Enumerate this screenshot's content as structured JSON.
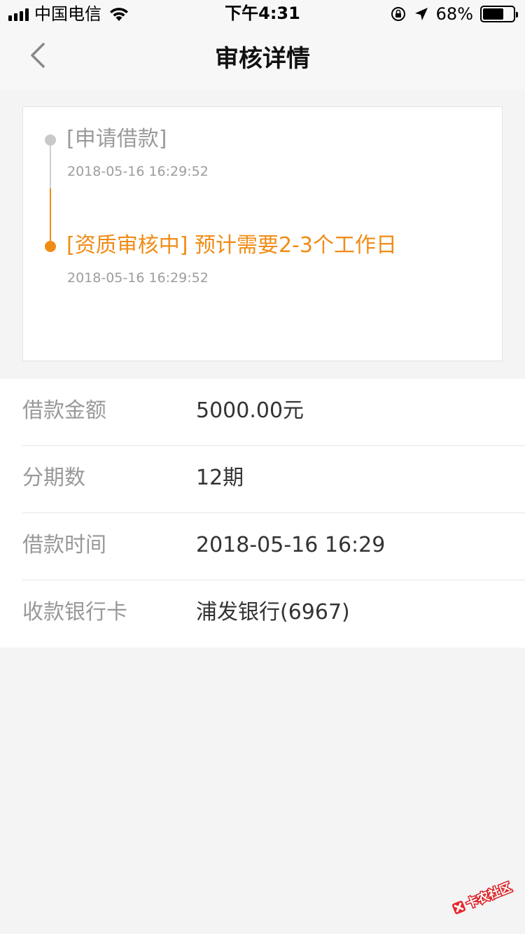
{
  "status_bar": {
    "carrier": "中国电信",
    "time": "下午4:31",
    "battery": "68%",
    "battery_level": 0.68
  },
  "nav": {
    "title": "审核详情"
  },
  "timeline": [
    {
      "title": "[申请借款]",
      "time": "2018-05-16 16:29:52",
      "status": "done"
    },
    {
      "title": "[资质审核中] 预计需要2-3个工作日",
      "time": "2018-05-16 16:29:52",
      "status": "active"
    }
  ],
  "details": [
    {
      "label": "借款金额",
      "value": "5000.00元"
    },
    {
      "label": "分期数",
      "value": "12期"
    },
    {
      "label": "借款时间",
      "value": "2018-05-16 16:29"
    },
    {
      "label": "收款银行卡",
      "value": "浦发银行(6967)"
    }
  ],
  "watermark": {
    "text": "卡农社区"
  },
  "colors": {
    "accent": "#f08c16",
    "background": "#f4f4f4"
  }
}
